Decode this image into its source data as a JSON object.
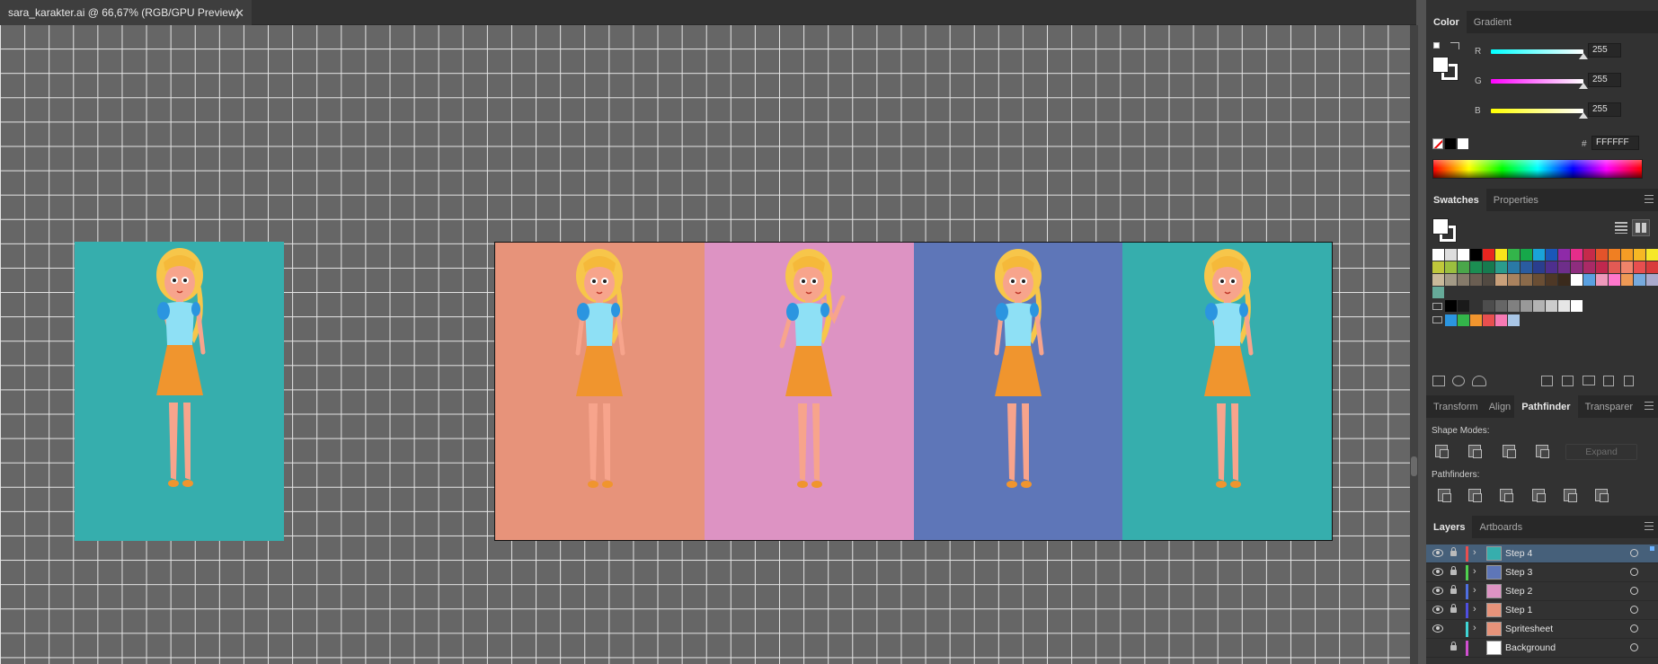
{
  "document": {
    "tab_title": "sara_karakter.ai @ 66,67% (RGB/GPU Preview)",
    "close_glyph": "✕"
  },
  "artboards": {
    "single_color": "#36aead",
    "sheet_colors": [
      "#e7937a",
      "#dd93c3",
      "#5e76b8",
      "#36aead"
    ]
  },
  "color_panel": {
    "tabs": [
      "Color",
      "Gradient"
    ],
    "channels": [
      {
        "label": "R",
        "value": "255",
        "gradient": "linear-gradient(90deg,#00ffff,#ffffff)"
      },
      {
        "label": "G",
        "value": "255",
        "gradient": "linear-gradient(90deg,#ff00ff,#ffffff)"
      },
      {
        "label": "B",
        "value": "255",
        "gradient": "linear-gradient(90deg,#ffff00,#ffffff)"
      }
    ],
    "hex_label": "#",
    "hex_value": "FFFFFF"
  },
  "swatches_panel": {
    "tabs": [
      "Swatches",
      "Properties"
    ]
  },
  "pathfinder_panel": {
    "tabs": [
      "Transform",
      "Align",
      "Pathfinder",
      "Transparer"
    ],
    "shape_modes_label": "Shape Modes:",
    "expand_label": "Expand",
    "pathfinders_label": "Pathfinders:"
  },
  "layers_panel": {
    "tabs": [
      "Layers",
      "Artboards"
    ],
    "layers": [
      {
        "name": "Step 4",
        "color": "#e84f4f",
        "thumb": "#36aead",
        "selected": true,
        "locked": true
      },
      {
        "name": "Step 3",
        "color": "#4fd14f",
        "thumb": "#5e76b8",
        "selected": false,
        "locked": true
      },
      {
        "name": "Step 2",
        "color": "#4f6fe0",
        "thumb": "#dd93c3",
        "selected": false,
        "locked": true
      },
      {
        "name": "Step 1",
        "color": "#4f4fe0",
        "thumb": "#e7937a",
        "selected": false,
        "locked": true
      },
      {
        "name": "Spritesheet",
        "color": "#3fd5d5",
        "thumb": "#e7937a",
        "selected": false,
        "locked": false
      },
      {
        "name": "Background",
        "color": "#d04fd0",
        "thumb": "#ffffff",
        "selected": false,
        "locked": true
      }
    ]
  }
}
